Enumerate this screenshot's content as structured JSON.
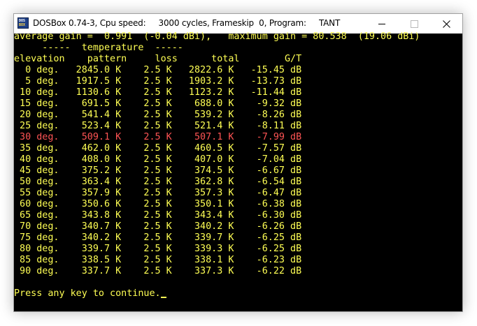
{
  "window": {
    "app_name": "DOSBox 0.74-3, Cpu speed:",
    "cycles": "3000 cycles, Frameskip  0, Program:",
    "program": "TANT",
    "icon_top": "DOS",
    "icon_bottom": "BOX"
  },
  "colors": {
    "text": "#ffff54",
    "highlight": "#ff5454",
    "screen_bg": "#000000"
  },
  "console": {
    "summary": "average gain =  0.991  (-0.04 dBi),   maximum gain = 80.538  (19.06 dBi)",
    "group_header": "     -----  temperature  -----",
    "column_header": "elevation    pattern     loss      total        G/T",
    "rows": [
      {
        "text": "  0 deg.   2845.0 K    2.5 K   2822.6 K   -15.45 dB",
        "highlight": false
      },
      {
        "text": "  5 deg.   1917.5 K    2.5 K   1903.2 K   -13.73 dB",
        "highlight": false
      },
      {
        "text": " 10 deg.   1130.6 K    2.5 K   1123.2 K   -11.44 dB",
        "highlight": false
      },
      {
        "text": " 15 deg.    691.5 K    2.5 K    688.0 K    -9.32 dB",
        "highlight": false
      },
      {
        "text": " 20 deg.    541.4 K    2.5 K    539.2 K    -8.26 dB",
        "highlight": false
      },
      {
        "text": " 25 deg.    523.4 K    2.5 K    521.4 K    -8.11 dB",
        "highlight": false
      },
      {
        "text": " 30 deg.    509.1 K    2.5 K    507.1 K    -7.99 dB",
        "highlight": true
      },
      {
        "text": " 35 deg.    462.0 K    2.5 K    460.5 K    -7.57 dB",
        "highlight": false
      },
      {
        "text": " 40 deg.    408.0 K    2.5 K    407.0 K    -7.04 dB",
        "highlight": false
      },
      {
        "text": " 45 deg.    375.2 K    2.5 K    374.5 K    -6.67 dB",
        "highlight": false
      },
      {
        "text": " 50 deg.    363.4 K    2.5 K    362.8 K    -6.54 dB",
        "highlight": false
      },
      {
        "text": " 55 deg.    357.9 K    2.5 K    357.3 K    -6.47 dB",
        "highlight": false
      },
      {
        "text": " 60 deg.    350.6 K    2.5 K    350.1 K    -6.38 dB",
        "highlight": false
      },
      {
        "text": " 65 deg.    343.8 K    2.5 K    343.4 K    -6.30 dB",
        "highlight": false
      },
      {
        "text": " 70 deg.    340.7 K    2.5 K    340.2 K    -6.26 dB",
        "highlight": false
      },
      {
        "text": " 75 deg.    340.2 K    2.5 K    339.7 K    -6.25 dB",
        "highlight": false
      },
      {
        "text": " 80 deg.    339.7 K    2.5 K    339.3 K    -6.25 dB",
        "highlight": false
      },
      {
        "text": " 85 deg.    338.5 K    2.5 K    338.1 K    -6.23 dB",
        "highlight": false
      },
      {
        "text": " 90 deg.    337.7 K    2.5 K    337.3 K    -6.22 dB",
        "highlight": false
      }
    ],
    "prompt": "Press any key to continue."
  }
}
